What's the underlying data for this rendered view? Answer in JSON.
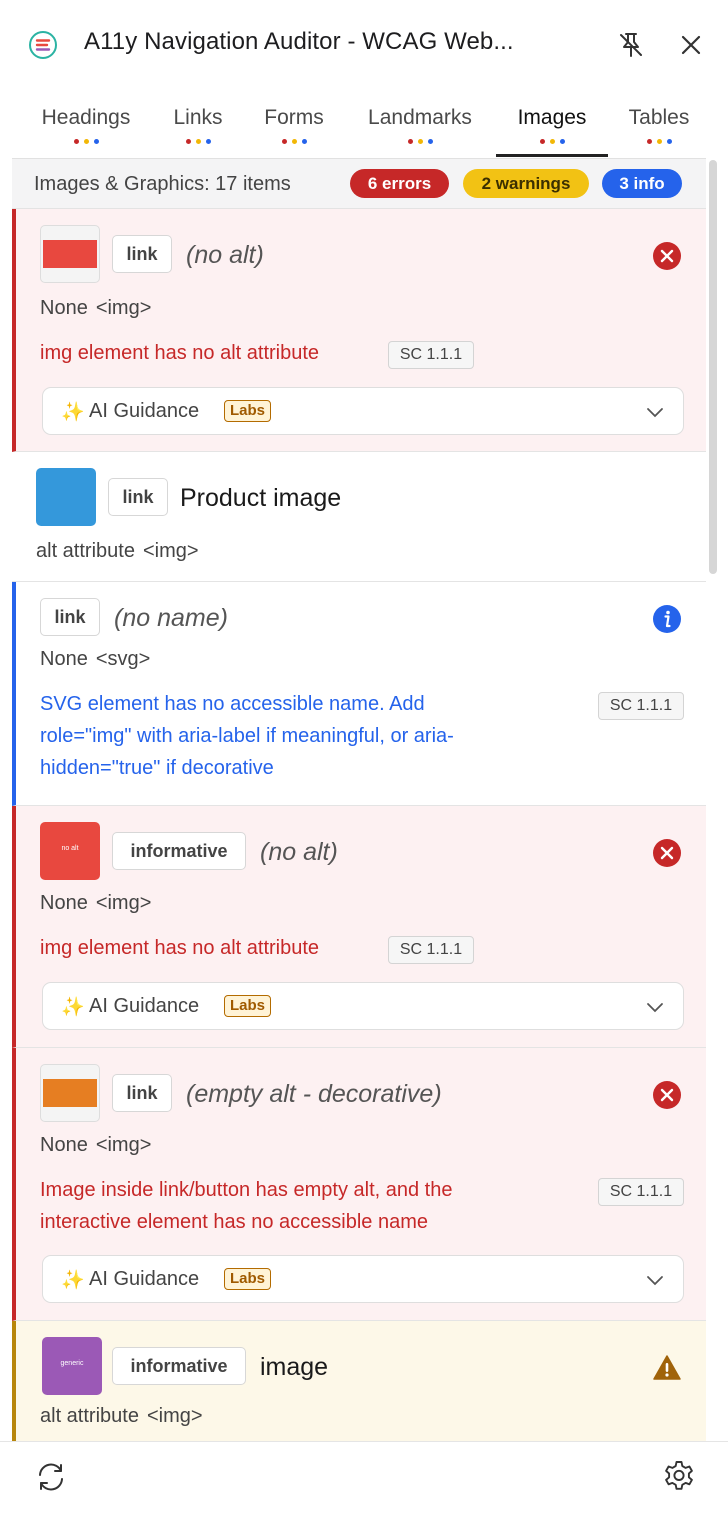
{
  "header": {
    "title": "A11y Navigation Auditor - WCAG Web...",
    "icons": {
      "logo": "list-logo-icon",
      "pin": "unpin-icon",
      "close": "close-icon"
    }
  },
  "tabs": [
    {
      "label": "Headings"
    },
    {
      "label": "Links"
    },
    {
      "label": "Forms"
    },
    {
      "label": "Landmarks"
    },
    {
      "label": "Images",
      "active": true
    },
    {
      "label": "Tables"
    }
  ],
  "summary": {
    "text": "Images & Graphics: 17 items",
    "errors": "6 errors",
    "warnings": "2 warnings",
    "info": "3 info"
  },
  "items": [
    {
      "severity": "error",
      "tag": "link",
      "name": "(no alt)",
      "source": "None",
      "element": "<img>",
      "message": "img element has no alt attribute",
      "sc": "SC 1.1.1",
      "guidance_label": "AI Guidance",
      "labs": "Labs"
    },
    {
      "severity": "none",
      "tag": "link",
      "name": "Product image",
      "source": "alt attribute",
      "element": "<img>"
    },
    {
      "severity": "info",
      "tag": "link",
      "name": "(no name)",
      "source": "None",
      "element": "<svg>",
      "message_lines": [
        "SVG element has no accessible name. Add",
        "role=\"img\" with aria-label if meaningful, or aria-",
        "hidden=\"true\" if decorative"
      ],
      "sc": "SC 1.1.1"
    },
    {
      "severity": "error",
      "tag": "informative",
      "thumb_text": "no alt",
      "name": "(no alt)",
      "source": "None",
      "element": "<img>",
      "message": "img element has no alt attribute",
      "sc": "SC 1.1.1",
      "guidance_label": "AI Guidance",
      "labs": "Labs"
    },
    {
      "severity": "error",
      "tag": "link",
      "name": "(empty alt - decorative)",
      "source": "None",
      "element": "<img>",
      "message_lines": [
        "Image inside link/button has empty alt, and the",
        "interactive element has no accessible name"
      ],
      "sc": "SC 1.1.1",
      "guidance_label": "AI Guidance",
      "labs": "Labs"
    },
    {
      "severity": "warning",
      "tag": "informative",
      "thumb_text": "generic",
      "name": "image",
      "source": "alt attribute",
      "element": "<img>"
    }
  ],
  "colors": {
    "error": "#c62828",
    "warning": "#f2c214",
    "info": "#2563eb",
    "thumb_red": "#e8483f",
    "thumb_blue": "#3498db",
    "thumb_orange": "#e67e22",
    "thumb_purple": "#9b59b6"
  },
  "footer": {
    "icons": {
      "refresh": "refresh-icon",
      "settings": "gear-icon"
    }
  }
}
